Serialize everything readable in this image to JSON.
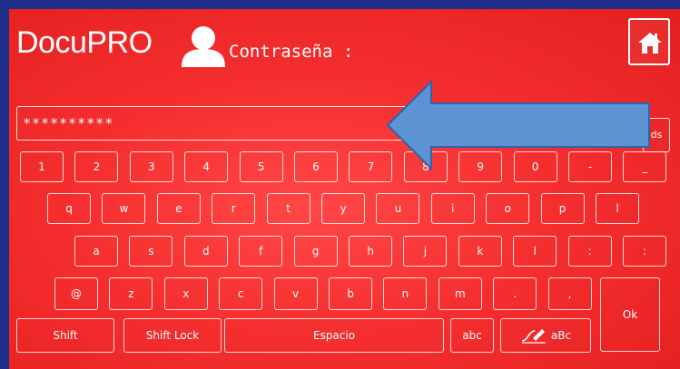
{
  "header": {
    "logo_text": "DocuPRO",
    "password_label": "Contraseña :"
  },
  "password_field": {
    "masked_value": "**********"
  },
  "delete_key": {
    "label": "ds"
  },
  "keyboard": {
    "row1": [
      "1",
      "2",
      "3",
      "4",
      "5",
      "6",
      "7",
      "8",
      "9",
      "0",
      "-",
      "_"
    ],
    "row2": [
      "q",
      "w",
      "e",
      "r",
      "t",
      "y",
      "u",
      "i",
      "o",
      "p",
      "l"
    ],
    "row3": [
      "a",
      "s",
      "d",
      "f",
      "g",
      "h",
      "j",
      "k",
      "l",
      ":",
      ":"
    ],
    "row4": [
      "@",
      "z",
      "x",
      "c",
      "v",
      "b",
      "n",
      "m",
      ".",
      ","
    ],
    "ok_label": "Ok",
    "shift_label": "Shift",
    "shift_lock_label": "Shift Lock",
    "space_label": "Espacio",
    "abc_label": "abc",
    "mode_label": "aBc"
  },
  "colors": {
    "screen_red": "#f52f2f",
    "frame_blue": "#1d2f8a",
    "arrow_blue": "#5b93d3"
  },
  "icons": [
    "user-icon",
    "home-icon",
    "left-arrow-annotation",
    "handwriting-icon"
  ]
}
